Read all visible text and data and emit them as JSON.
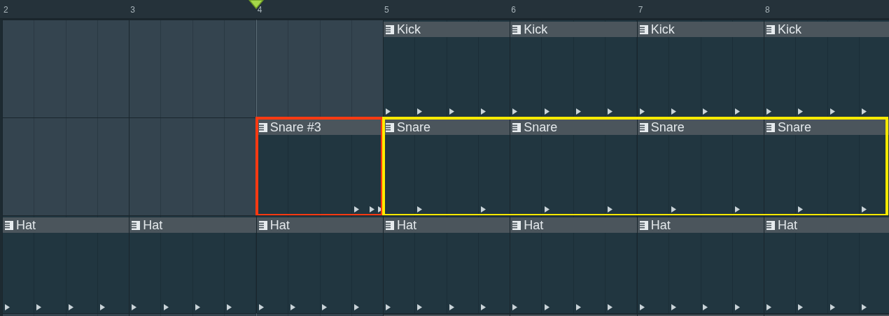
{
  "ruler": {
    "bars": [
      {
        "label": "2",
        "playhead": false
      },
      {
        "label": "3",
        "playhead": false
      },
      {
        "label": "4",
        "playhead": true
      },
      {
        "label": "5",
        "playhead": false
      },
      {
        "label": "6",
        "playhead": false
      },
      {
        "label": "7",
        "playhead": false
      },
      {
        "label": "8",
        "playhead": false
      }
    ]
  },
  "tracks": [
    {
      "slots": [
        {
          "kind": "empty"
        },
        {
          "kind": "empty"
        },
        {
          "kind": "empty"
        },
        {
          "kind": "kick",
          "name": "Kick"
        },
        {
          "kind": "kick",
          "name": "Kick"
        },
        {
          "kind": "kick",
          "name": "Kick"
        },
        {
          "kind": "kick",
          "name": "Kick"
        }
      ]
    },
    {
      "slots": [
        {
          "kind": "empty"
        },
        {
          "kind": "empty"
        },
        {
          "kind": "fill",
          "name": "Snare #3",
          "color": "#ff3a12"
        },
        {
          "kind": "snare",
          "name": "Snare",
          "color": "#ffea00"
        },
        {
          "kind": "snare",
          "name": "Snare",
          "color": "#ffea00"
        },
        {
          "kind": "snare",
          "name": "Snare",
          "color": "#ffea00"
        },
        {
          "kind": "snare",
          "name": "Snare",
          "color": "#ffea00"
        }
      ]
    },
    {
      "slots": [
        {
          "kind": "hat",
          "name": "Hat"
        },
        {
          "kind": "hat",
          "name": "Hat"
        },
        {
          "kind": "hat",
          "name": "Hat"
        },
        {
          "kind": "hat",
          "name": "Hat"
        },
        {
          "kind": "hat",
          "name": "Hat"
        },
        {
          "kind": "hat",
          "name": "Hat"
        },
        {
          "kind": "hat",
          "name": "Hat"
        }
      ]
    },
    {
      "slots": [
        {
          "kind": "empty"
        },
        {
          "kind": "empty"
        },
        {
          "kind": "empty"
        },
        {
          "kind": "cut"
        },
        {
          "kind": "cut"
        },
        {
          "kind": "cut"
        },
        {
          "kind": "cut"
        }
      ]
    }
  ]
}
